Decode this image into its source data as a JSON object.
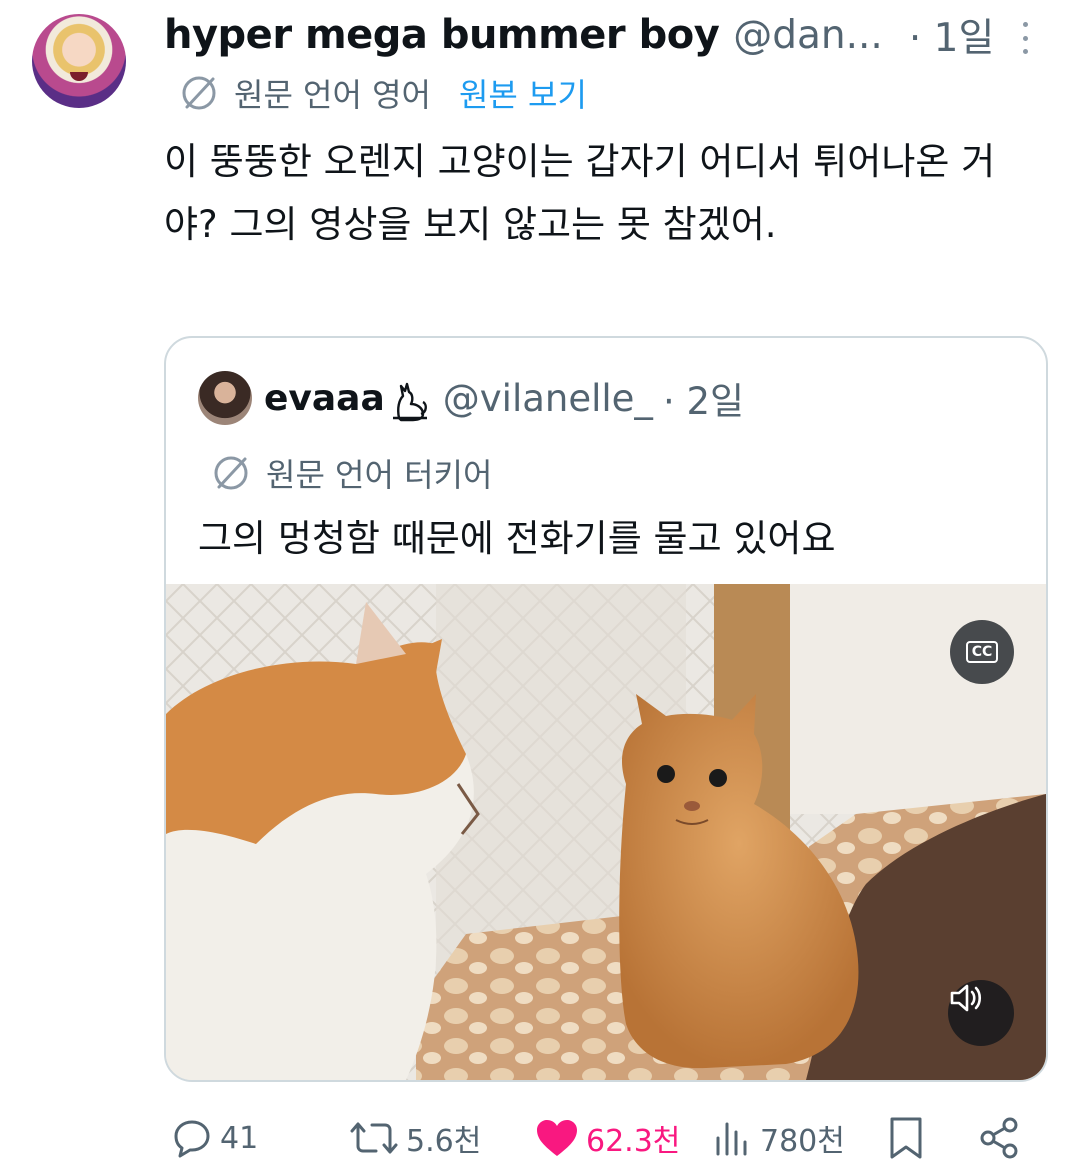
{
  "tweet": {
    "display_name": "hyper mega bummer boy",
    "handle": "@dan...",
    "time": "· 1일",
    "translation": {
      "label": "원문 언어 영어",
      "show_original": "원본 보기"
    },
    "text": "이 뚱뚱한 오렌지 고양이는 갑자기 어디서 튀어나온 거야? 그의 영상을 보지 않고는 못 참겠어."
  },
  "quote": {
    "display_name": "evaaa",
    "handle": "@vilanelle_",
    "time": "· 2일",
    "translation_label": "원문 언어 터키어",
    "text": "그의 멍청함 때문에 전화기를 물고 있어요",
    "cc_label": "CC"
  },
  "actions": {
    "replies": "41",
    "reposts": "5.6천",
    "likes": "62.3천",
    "views": "780천"
  },
  "colors": {
    "link": "#1d9bf0",
    "like": "#f91880",
    "secondary": "#536471"
  }
}
